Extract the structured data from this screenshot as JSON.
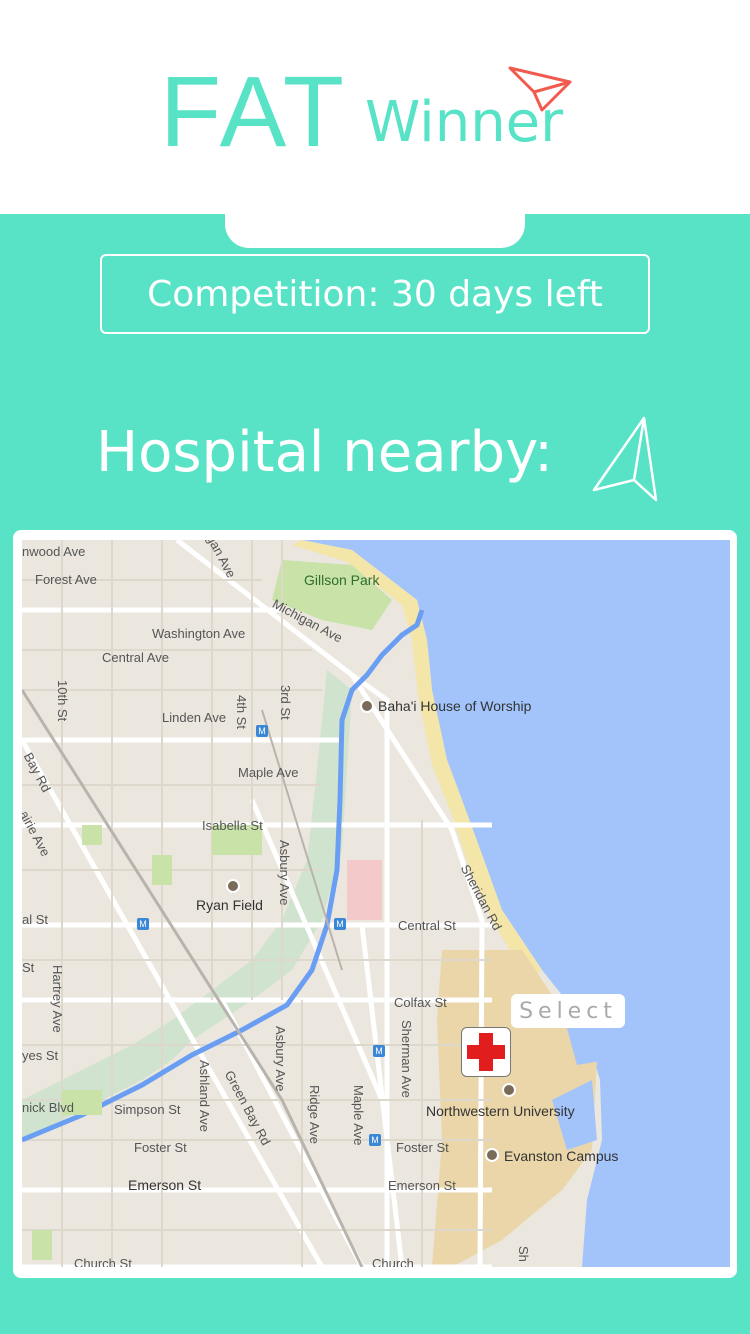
{
  "header": {
    "logo_fat": "FAT",
    "logo_winner": "Winner",
    "logo_icon": "paper-plane-icon"
  },
  "competition": {
    "text": "Competition: 30 days left"
  },
  "hospital": {
    "title": "Hospital nearby:",
    "nav_icon": "navigation-arrow-icon"
  },
  "map": {
    "select_label": "Select",
    "marker_icon": "red-cross-icon",
    "labels": {
      "hawood": "nwood Ave",
      "gan": "gan Ave",
      "forest": "Forest Ave",
      "gillson": "Gillson Park",
      "michigan": "Michigan Ave",
      "washington": "Washington Ave",
      "central_top": "Central Ave",
      "tenth": "10th St",
      "fourth": "4th St",
      "third": "3rd St",
      "bahai": "Baha'i House of Worship",
      "linden": "Linden Ave",
      "bay": "Bay Rd",
      "maple_top": "Maple Ave",
      "prairie": "airie Ave",
      "isabella": "Isabella St",
      "asbury_top": "Asbury Ave",
      "sheridan": "Sheridan Rd",
      "ryan": "Ryan Field",
      "al_st": "al St",
      "central_st": "Central St",
      "hartrey": "Hartrey Ave",
      "st_left": "St",
      "colfax": "Colfax St",
      "yes": "yes St",
      "asbury_mid": "Asbury Ave",
      "sherman": "Sherman Ave",
      "ashland": "Ashland Ave",
      "greenbay": "Green Bay Rd",
      "nick": "nick Blvd",
      "simpson": "Simpson St",
      "ridge": "Ridge Ave",
      "maple_low": "Maple Ave",
      "northwestern": "Northwestern University",
      "foster_left": "Foster St",
      "foster_right": "Foster St",
      "evanston": "Evanston Campus",
      "emerson_left": "Emerson St",
      "emerson_right": "Emerson St",
      "church_left": "Church St",
      "church_right": "Church",
      "sh": "Sh"
    }
  }
}
